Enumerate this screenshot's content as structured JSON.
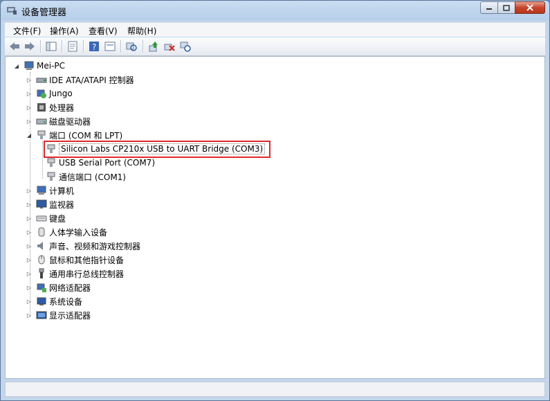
{
  "window": {
    "title": "设备管理器"
  },
  "menu": [
    "文件(F)",
    "操作(A)",
    "查看(V)",
    "帮助(H)"
  ],
  "toolbar": [
    "back-icon",
    "forward-icon",
    "console-tree-icon",
    "properties-icon",
    "help-icon",
    "view-icon",
    "show-device-icon",
    "update-driver-icon",
    "uninstall-icon",
    "scan-hardware-icon"
  ],
  "tree": {
    "root": "Mei-PC",
    "categories": [
      "IDE ATA/ATAPI 控制器",
      "Jungo",
      "处理器",
      "磁盘驱动器",
      "端口 (COM 和 LPT)",
      "计算机",
      "监视器",
      "键盘",
      "人体学输入设备",
      "声音、视频和游戏控制器",
      "鼠标和其他指针设备",
      "通用串行总线控制器",
      "网络适配器",
      "系统设备",
      "显示适配器"
    ],
    "ports": [
      "Silicon Labs CP210x USB to UART Bridge (COM3)",
      "USB Serial Port (COM7)",
      "通信端口 (COM1)"
    ]
  },
  "colors": {
    "highlight": "#e0282d",
    "close": "#c7452c"
  }
}
